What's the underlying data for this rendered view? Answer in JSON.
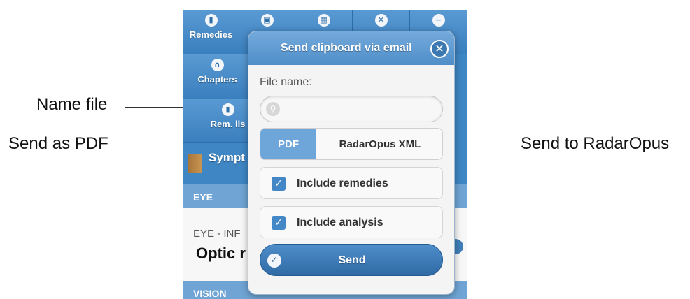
{
  "annotations": {
    "name_file": "Name file",
    "send_as_pdf": "Send as PDF",
    "send_to_radaropus": "Send to RadarOpus"
  },
  "app": {
    "grid": [
      {
        "label": "Remedies",
        "icon": "remedy-icon",
        "glyph": "▮"
      },
      {
        "label": "Chapters",
        "icon": "chapter-icon",
        "glyph": "∩"
      },
      {
        "label": "Rem. lis",
        "icon": "remedy-list-icon",
        "glyph": "▮"
      }
    ],
    "top_icons": [
      "remedy-icon",
      "profile-icon",
      "calculator-icon",
      "close-icon",
      "minus-icon"
    ],
    "sympt_label": "Sympt",
    "eye_section": "EYE",
    "eye_sub": "EYE - INF",
    "optic": "Optic r",
    "vision_section": "VISION"
  },
  "dialog": {
    "title": "Send clipboard via email",
    "file_name_label": "File name:",
    "file_name_value": "",
    "file_name_placeholder": "",
    "format": {
      "pdf": "PDF",
      "xml": "RadarOpus XML",
      "selected": "PDF"
    },
    "include_remedies": {
      "label": "Include remedies",
      "checked": true
    },
    "include_analysis": {
      "label": "Include analysis",
      "checked": true
    },
    "send_label": "Send"
  },
  "colors": {
    "accent": "#4f8ec9",
    "selected_segment": "#6fa6da"
  }
}
